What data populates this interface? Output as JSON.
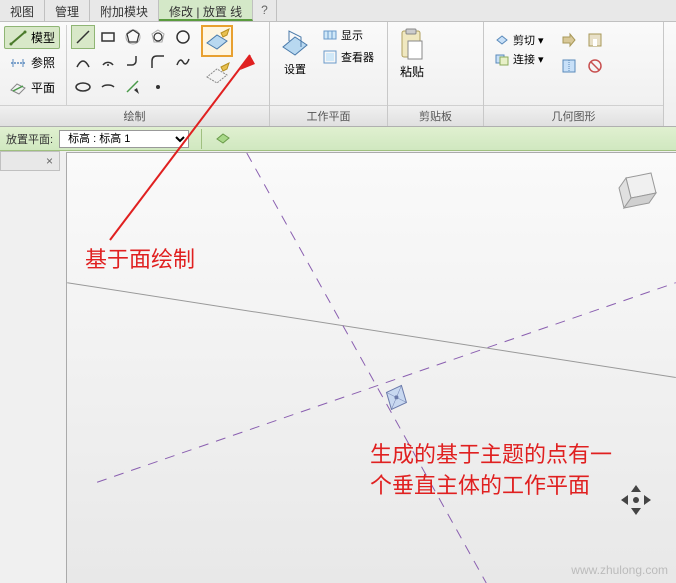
{
  "tabs": {
    "items": [
      "视图",
      "管理",
      "附加模块",
      "修改 | 放置 线"
    ],
    "active_index": 3,
    "help": "?"
  },
  "ribbon": {
    "draw": {
      "label": "绘制",
      "modes": {
        "model": "模型",
        "reference": "参照",
        "plane": "平面"
      }
    },
    "workplane": {
      "label": "工作平面",
      "set": "设置",
      "show": "显示",
      "viewer": "查看器"
    },
    "clipboard": {
      "label": "剪贴板",
      "paste": "粘贴",
      "cut": "剪切",
      "link": "连接"
    },
    "geometry": {
      "label": "几何图形"
    }
  },
  "options": {
    "label": "放置平面:",
    "value": "标高 : 标高 1"
  },
  "annotations": {
    "anno1": "基于面绘制",
    "anno2": "生成的基于主题的点有一个垂直主体的工作平面"
  },
  "watermark": "www.zhulong.com",
  "viewport": {
    "close": "×"
  }
}
